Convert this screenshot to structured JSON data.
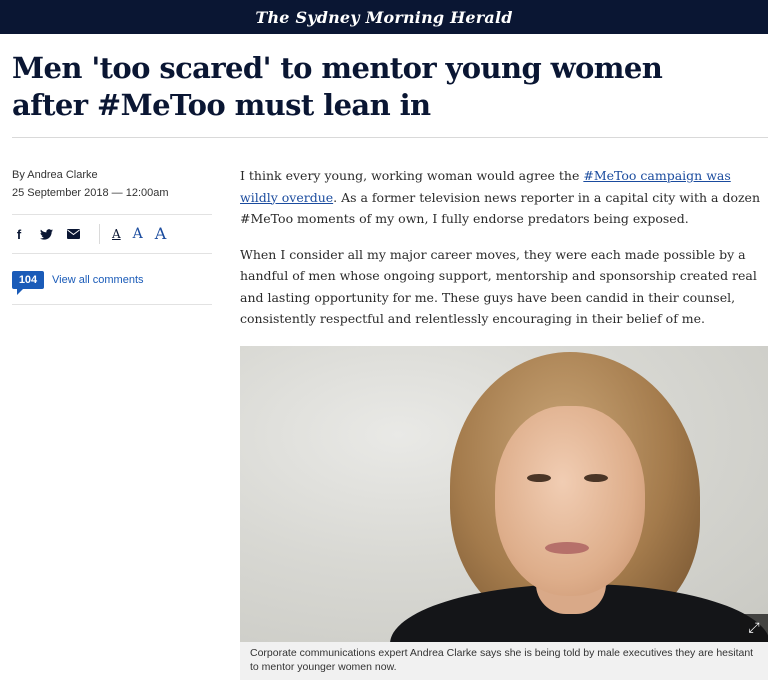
{
  "masthead": {
    "logo_text": "The Sydney Morning Herald"
  },
  "article": {
    "headline": "Men 'too scared' to mentor young women after #MeToo must lean in",
    "byline": "By Andrea Clarke",
    "date": "25 September 2018 — 12:00am",
    "share": {
      "facebook_glyph": "f",
      "twitter_glyph": "🐦",
      "email_glyph": "✉",
      "font_sizes": [
        "A",
        "A",
        "A"
      ]
    },
    "comments": {
      "count": "104",
      "label": "View all comments"
    },
    "paragraphs": {
      "p1_before": "I think every young, working woman would agree the ",
      "p1_link": "#MeToo campaign was wildly overdue",
      "p1_after": ". As a former television news reporter in a capital city with a dozen #MeToo moments of my own, I fully endorse predators being exposed.",
      "p2": "When I consider all my major career moves, they were each made possible by a handful of men whose ongoing support, mentorship and sponsorship created real and lasting opportunity for me. These guys have been candid in their counsel, consistently respectful and relentlessly encouraging in their belief of me."
    },
    "image": {
      "expand_glyph": "⤢",
      "caption": "Corporate communications expert Andrea Clarke says she is being told by male executives they are hesitant to mentor younger women now."
    }
  },
  "colors": {
    "masthead_bg": "#0a1633",
    "link": "#1a4b9e",
    "badge": "#1a5bb8"
  }
}
